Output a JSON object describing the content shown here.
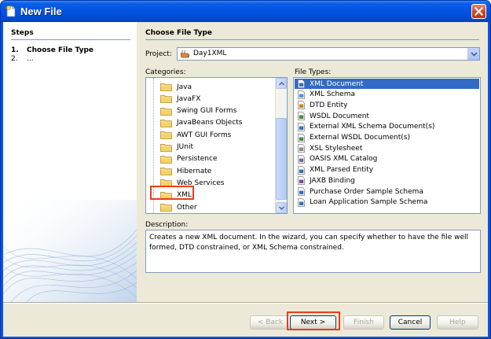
{
  "window": {
    "title": "New File"
  },
  "steps": {
    "title": "Steps",
    "items": [
      {
        "num": "1.",
        "label": "Choose File Type"
      },
      {
        "num": "2.",
        "label": "..."
      }
    ]
  },
  "main": {
    "title": "Choose File Type",
    "project_label": "Project:",
    "project_value": "Day1XML",
    "categories_label": "Categories:",
    "filetypes_label": "File Types:",
    "categories": [
      "Java",
      "JavaFX",
      "Swing GUI Forms",
      "JavaBeans Objects",
      "AWT GUI Forms",
      "JUnit",
      "Persistence",
      "Hibernate",
      "Web Services",
      "XML",
      "Other"
    ],
    "file_types": [
      "XML Document",
      "XML Schema",
      "DTD Entity",
      "WSDL Document",
      "External XML Schema Document(s)",
      "External WSDL Document(s)",
      "XSL Stylesheet",
      "OASIS XML Catalog",
      "XML Parsed Entity",
      "JAXB Binding",
      "Purchase Order Sample Schema",
      "Loan Application Sample Schema"
    ],
    "selected_file_type": "XML Document",
    "description_label": "Description:",
    "description": "Creates a new XML document. In the wizard, you can specify whether to have the file well formed, DTD constrained, or XML Schema constrained."
  },
  "buttons": {
    "back": "< Back",
    "next": "Next >",
    "finish": "Finish",
    "cancel": "Cancel",
    "help": "Help"
  },
  "colors": {
    "titlebar": "#0353e2",
    "selection": "#316ac5",
    "highlight": "#e83e1a",
    "folder": "#f3d36b"
  }
}
